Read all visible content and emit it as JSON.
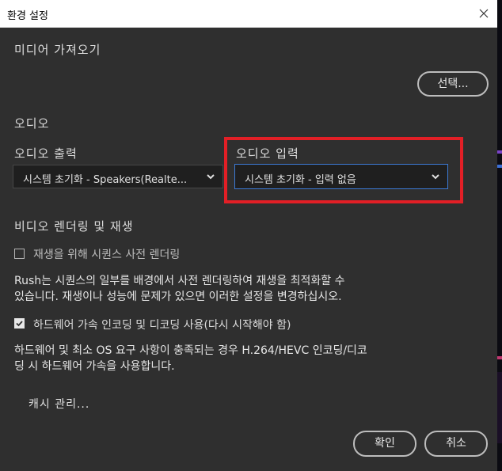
{
  "window": {
    "title": "환경 설정"
  },
  "media_import": {
    "title": "미디어 가져오기",
    "select_button": "선택..."
  },
  "audio": {
    "title": "오디오",
    "output_label": "오디오 출력",
    "output_value": "시스템 초기화 - Speakers(Realte...",
    "input_label": "오디오 입력",
    "input_value": "시스템 초기화 - 입력 없음"
  },
  "video": {
    "title": "비디오 렌더링 및 재생",
    "prerender_checkbox": {
      "label": "재생을 위해 시퀀스 사전 렌더링",
      "checked": false
    },
    "prerender_desc_1": "Rush는 시퀀스의 일부를 배경에서 사전 렌더링하여 재생을 최적화할 수",
    "prerender_desc_2": "있습니다. 재생이나 성능에 문제가 있으면 이러한 설정을 변경하십시오.",
    "hw_checkbox": {
      "label": "하드웨어 가속 인코딩 및 디코딩 사용(다시 시작해야 함)",
      "checked": true
    },
    "hw_desc_1": "하드웨어 및 최소 OS 요구 사항이 충족되는 경우 H.264/HEVC 인코딩/디코",
    "hw_desc_2": "딩 시 하드웨어 가속을 사용합니다."
  },
  "cache": {
    "link": "캐시 관리..."
  },
  "footer": {
    "ok": "확인",
    "cancel": "취소"
  },
  "colors": {
    "dialog_bg": "#2f2f2f",
    "highlight": "#e21f26",
    "text": "#dcdcdc"
  }
}
